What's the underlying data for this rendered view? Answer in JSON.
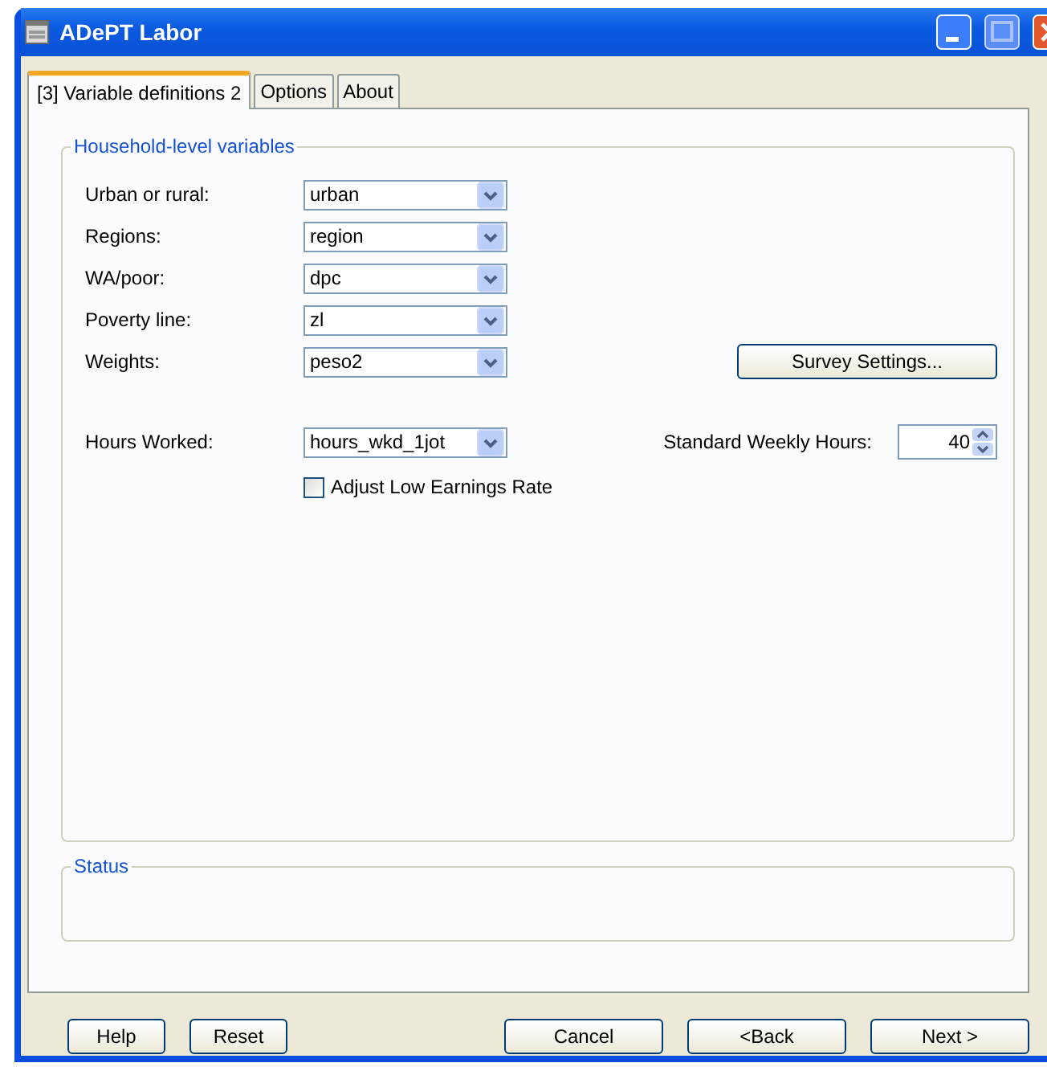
{
  "window": {
    "title": "ADePT Labor"
  },
  "tabs": [
    {
      "label": "[3] Variable definitions 2",
      "selected": true
    },
    {
      "label": "Options",
      "selected": false
    },
    {
      "label": "About",
      "selected": false
    }
  ],
  "household_group": {
    "title": "Household-level variables",
    "fields": [
      {
        "label": "Urban or rural:",
        "value": "urban"
      },
      {
        "label": "Regions:",
        "value": "region"
      },
      {
        "label": "WA/poor:",
        "value": "dpc"
      },
      {
        "label": "Poverty line:",
        "value": "zl"
      },
      {
        "label": "Weights:",
        "value": "peso2"
      }
    ],
    "survey_button": "Survey Settings...",
    "hours_worked": {
      "label": "Hours Worked:",
      "value": "hours_wkd_1jot"
    },
    "standard_weekly_hours": {
      "label": "Standard Weekly Hours:",
      "value": "40"
    },
    "adjust_checkbox": {
      "label": "Adjust Low Earnings Rate",
      "checked": false
    }
  },
  "status_group": {
    "title": "Status"
  },
  "buttons_left": [
    "Help",
    "Reset"
  ],
  "buttons_right": [
    "Cancel",
    "<Back",
    "Next >"
  ]
}
